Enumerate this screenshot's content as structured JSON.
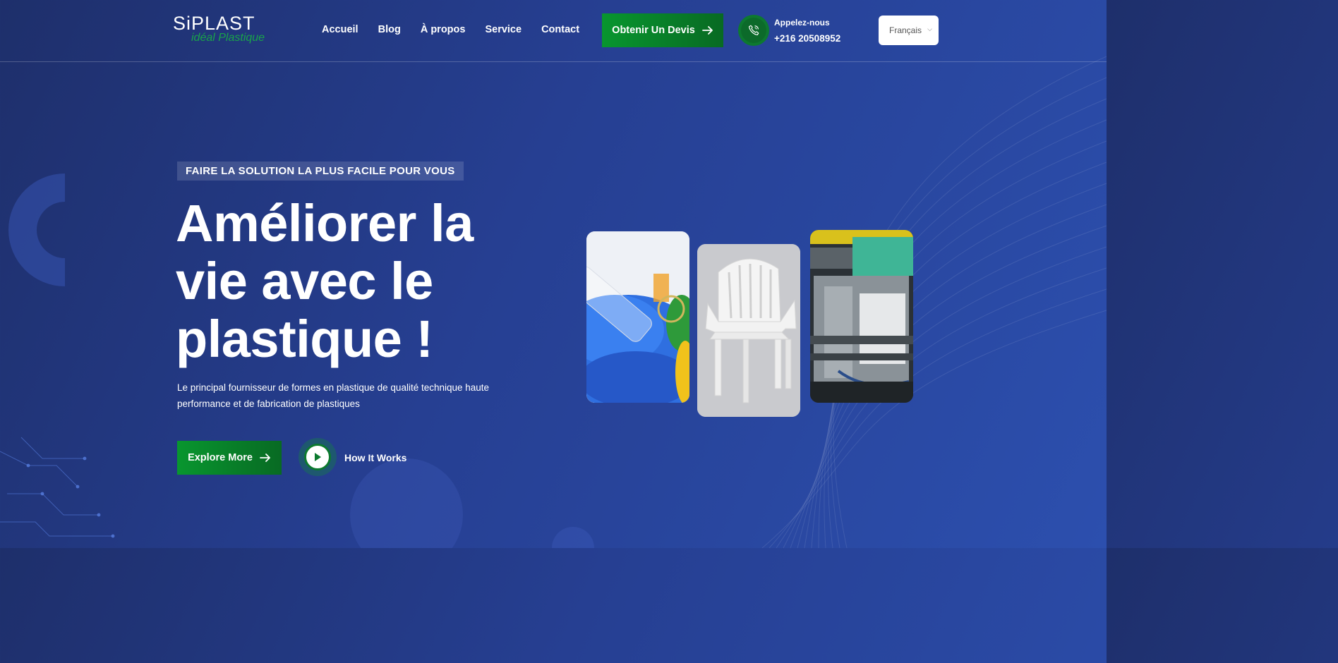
{
  "header": {
    "logo": {
      "brand": "SiPLAST",
      "tagline": "idéal Plastique"
    },
    "nav": [
      "Accueil",
      "Blog",
      "À propos",
      "Service",
      "Contact"
    ],
    "quote_button": "Obtenir Un Devis",
    "phone": {
      "label": "Appelez-nous",
      "number": "+216 20508952"
    },
    "language": {
      "selected": "Français"
    }
  },
  "hero": {
    "tagline": "FAIRE LA SOLUTION LA PLUS FACILE POUR VOUS",
    "headline": "Améliorer la vie avec le plastique !",
    "subtext": "Le principal fournisseur de formes en plastique de qualité technique haute performance et de fabrication de plastiques",
    "explore_button": "Explore More",
    "how_it_works": "How It Works"
  },
  "images": [
    {
      "name": "blue-plastic-pellets-image"
    },
    {
      "name": "white-plastic-chair-image"
    },
    {
      "name": "injection-molding-machine-image"
    }
  ],
  "colors": {
    "background": "#263f92",
    "accent_green": "#08962f",
    "logo_green": "#19a34a"
  }
}
